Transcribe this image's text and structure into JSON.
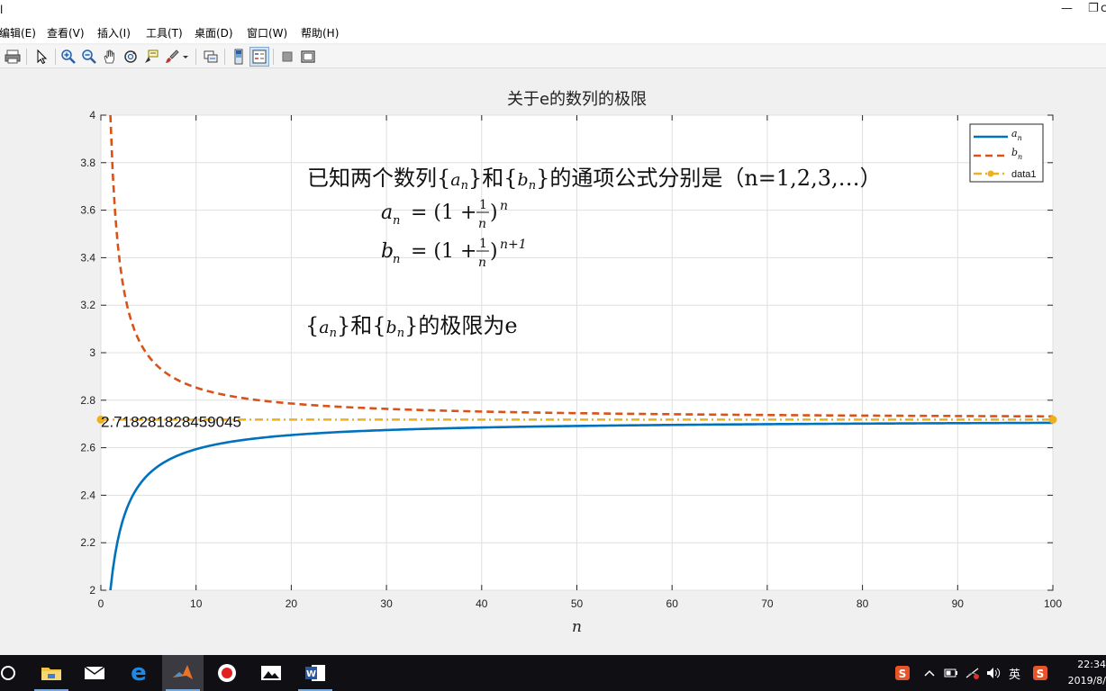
{
  "window": {
    "left_glyph": "l",
    "minimize": "—",
    "restore": "❐",
    "right_glyph": "c"
  },
  "menu": [
    {
      "label": "编辑(E)"
    },
    {
      "label": "查看(V)"
    },
    {
      "label": "插入(I)"
    },
    {
      "label": "工具(T)"
    },
    {
      "label": "桌面(D)"
    },
    {
      "label": "窗口(W)"
    },
    {
      "label": "帮助(H)"
    }
  ],
  "toolbar": {
    "buttons": [
      "print-icon",
      "pointer-icon",
      "zoom-in-icon",
      "zoom-out-icon",
      "pan-icon",
      "rotate-icon",
      "data-cursor-icon",
      "brush-icon",
      "brush-dropdown-icon",
      "link-icon",
      "colorbar-icon",
      "legend-icon",
      "hide-tools-icon",
      "docked-icon"
    ],
    "active": "legend-icon"
  },
  "chart_data": {
    "type": "line",
    "title": "关于e的数列的极限",
    "xlabel": "n",
    "ylabel": "",
    "xlim": [
      0,
      100
    ],
    "ylim": [
      2,
      4
    ],
    "xticks": [
      "0",
      "10",
      "20",
      "30",
      "40",
      "50",
      "60",
      "70",
      "80",
      "90",
      "100"
    ],
    "yticks": [
      "2",
      "2.2",
      "2.4",
      "2.6",
      "2.8",
      "3",
      "3.2",
      "3.4",
      "3.6",
      "3.8",
      "4"
    ],
    "grid": true,
    "legend_position": "top-right",
    "series": [
      {
        "name": "a_n",
        "style": "solid",
        "color": "#0072BD",
        "formula": "(1+1/n)^n",
        "n_range": [
          1,
          100
        ]
      },
      {
        "name": "b_n",
        "style": "dashed",
        "color": "#D95319",
        "formula": "(1+1/n)^(n+1)",
        "n_range": [
          1,
          100
        ]
      },
      {
        "name": "data1",
        "style": "dash-dot",
        "color": "#EDB120",
        "marker": "circle",
        "x": [
          0,
          100
        ],
        "y": [
          2.718281828459045,
          2.718281828459045
        ]
      }
    ],
    "legend_labels": [
      "a",
      "b",
      "data1"
    ],
    "legend_subscript": "n",
    "annotations": {
      "line1_prefix": "已知两个数列{",
      "line1_a": "a",
      "line1_mid": "}和{",
      "line1_b": "b",
      "line1_suffix": "}的通项公式分别是（n=1,2,3,…）",
      "sub_n": "n",
      "formula_a_lhs": "a",
      "formula_b_lhs": "b",
      "formula_eq": "= (1 +",
      "formula_one": "1",
      "formula_n": "n",
      "formula_close": ")",
      "exp_a": "n",
      "exp_b": "n+1",
      "limit_prefix": "{",
      "limit_a": "a",
      "limit_mid": "}和{",
      "limit_b": "b",
      "limit_suffix": "}的极限为e",
      "e_value_label": "2.718281828459045"
    }
  },
  "taskbar": {
    "items": [
      "cortana-circle-icon",
      "file-explorer-icon",
      "mail-icon",
      "edge-icon",
      "matlab-icon",
      "record-icon",
      "photos-icon",
      "word-icon"
    ],
    "active": "matlab-icon",
    "tray_lang": "英",
    "time": "22:34",
    "date": "2019/8/"
  }
}
